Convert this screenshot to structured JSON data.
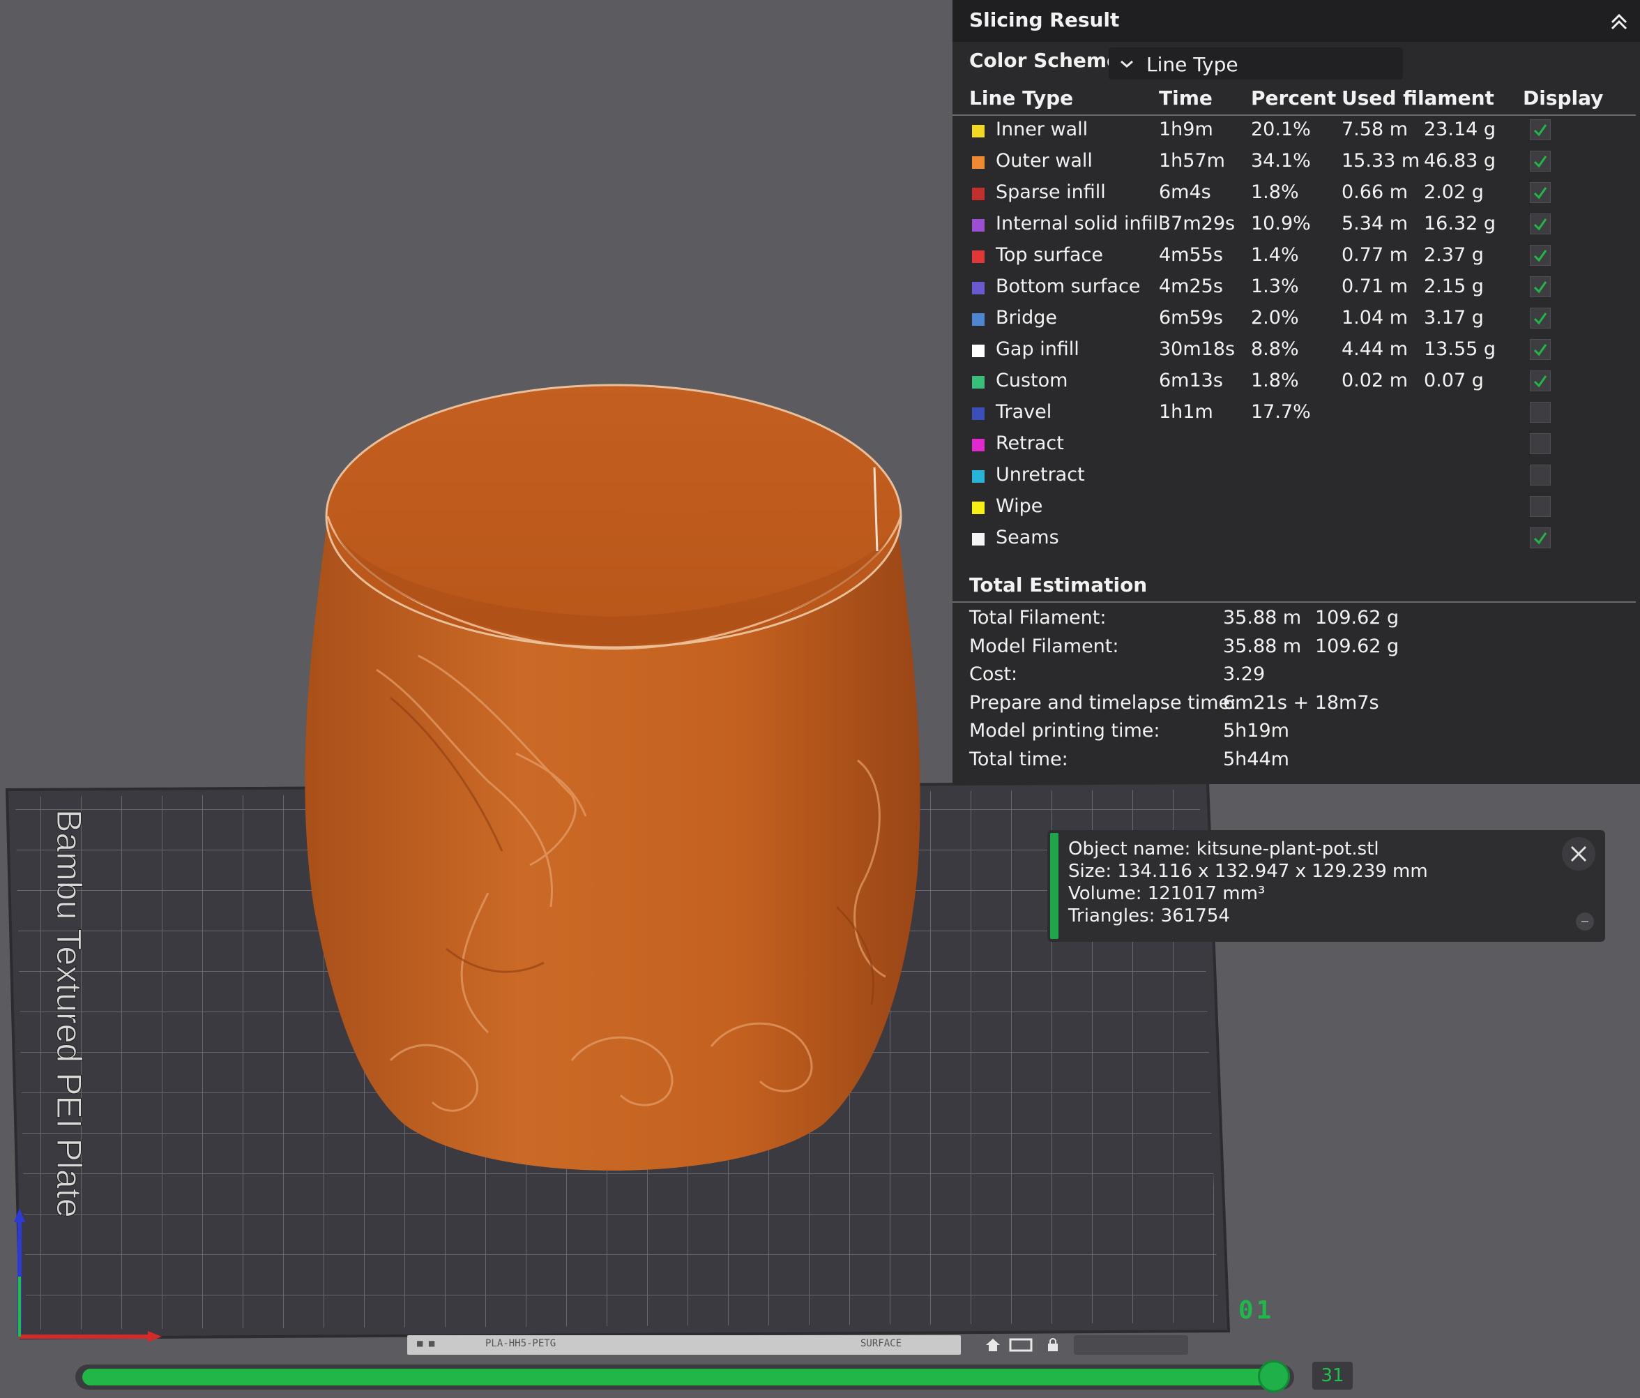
{
  "panel": {
    "title": "Slicing Result",
    "color_scheme_label": "Color Scheme",
    "color_scheme_value": "Line Type",
    "columns": [
      "Line Type",
      "Time",
      "Percent",
      "Used filament",
      "Display"
    ],
    "rows": [
      {
        "name": "Inner wall",
        "color": "#f2d822",
        "time": "1h9m",
        "percent": "20.1%",
        "length": "7.58 m",
        "weight": "23.14 g",
        "display": true
      },
      {
        "name": "Outer wall",
        "color": "#f08a32",
        "time": "1h57m",
        "percent": "34.1%",
        "length": "15.33 m",
        "weight": "46.83 g",
        "display": true
      },
      {
        "name": "Sparse infill",
        "color": "#c0302c",
        "time": "6m4s",
        "percent": "1.8%",
        "length": "0.66 m",
        "weight": "2.02 g",
        "display": true
      },
      {
        "name": "Internal solid infill",
        "color": "#9a50d0",
        "time": "37m29s",
        "percent": "10.9%",
        "length": "5.34 m",
        "weight": "16.32 g",
        "display": true
      },
      {
        "name": "Top surface",
        "color": "#e03838",
        "time": "4m55s",
        "percent": "1.4%",
        "length": "0.77 m",
        "weight": "2.37 g",
        "display": true
      },
      {
        "name": "Bottom surface",
        "color": "#6a5ad0",
        "time": "4m25s",
        "percent": "1.3%",
        "length": "0.71 m",
        "weight": "2.15 g",
        "display": true
      },
      {
        "name": "Bridge",
        "color": "#4f86d2",
        "time": "6m59s",
        "percent": "2.0%",
        "length": "1.04 m",
        "weight": "3.17 g",
        "display": true
      },
      {
        "name": "Gap infill",
        "color": "#ffffff",
        "time": "30m18s",
        "percent": "8.8%",
        "length": "4.44 m",
        "weight": "13.55 g",
        "display": true
      },
      {
        "name": "Custom",
        "color": "#36c07a",
        "time": "6m13s",
        "percent": "1.8%",
        "length": "0.02 m",
        "weight": "0.07 g",
        "display": true
      },
      {
        "name": "Travel",
        "color": "#3a4fb8",
        "time": "1h1m",
        "percent": "17.7%",
        "length": "",
        "weight": "",
        "display": false
      },
      {
        "name": "Retract",
        "color": "#e02ad0",
        "time": "",
        "percent": "",
        "length": "",
        "weight": "",
        "display": false
      },
      {
        "name": "Unretract",
        "color": "#28b4d8",
        "time": "",
        "percent": "",
        "length": "",
        "weight": "",
        "display": false
      },
      {
        "name": "Wipe",
        "color": "#f8f010",
        "time": "",
        "percent": "",
        "length": "",
        "weight": "",
        "display": false
      },
      {
        "name": "Seams",
        "color": "#f4f4f4",
        "time": "",
        "percent": "",
        "length": "",
        "weight": "",
        "display": true
      }
    ],
    "total_title": "Total Estimation",
    "totals": [
      {
        "label": "Total Filament:",
        "value1": "35.88 m",
        "value2": "109.62 g"
      },
      {
        "label": "Model Filament:",
        "value1": "35.88 m",
        "value2": "109.62 g"
      },
      {
        "label": "Cost:",
        "value1": "3.29",
        "value2": ""
      },
      {
        "label": "Prepare and timelapse time:",
        "value1": "6m21s + 18m7s",
        "value2": ""
      },
      {
        "label": "Model printing time:",
        "value1": "5h19m",
        "value2": ""
      },
      {
        "label": "Total time:",
        "value1": "5h44m",
        "value2": ""
      }
    ]
  },
  "object_info": {
    "name_line": "Object name: kitsune-plant-pot.stl",
    "size_line": "Size: 134.116 x 132.947 x 129.239 mm",
    "volume_line": "Volume: 121017 mm³",
    "triangles_line": "Triangles: 361754"
  },
  "plate": {
    "label": "Bambu Textured PEI Plate",
    "index": "01",
    "strip_left": "PLA-HH5-PETG",
    "strip_right": "SURFACE"
  },
  "layer_slider": {
    "value": "31",
    "fraction": 0.99
  },
  "colors": {
    "accent_green": "#22b648",
    "model_orange": "#c8621f",
    "panel_bg": "#2a2a2c",
    "viewport_bg": "#5b5b60"
  }
}
